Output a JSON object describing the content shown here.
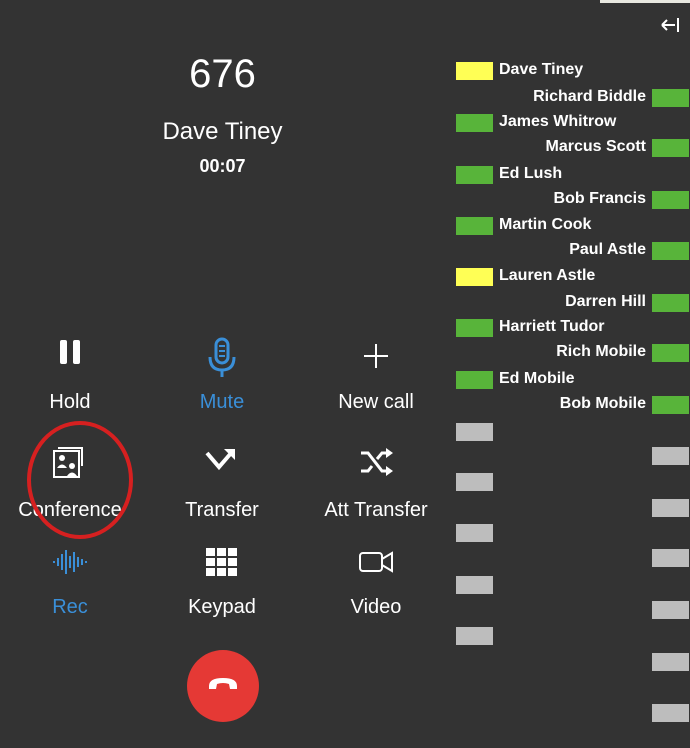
{
  "call": {
    "extension": "676",
    "name": "Dave Tiney",
    "timer": "00:07"
  },
  "controls": {
    "hold": {
      "label": "Hold",
      "icon": "pause-icon"
    },
    "mute": {
      "label": "Mute",
      "icon": "microphone-icon"
    },
    "new_call": {
      "label": "New call",
      "icon": "plus-icon"
    },
    "conference": {
      "label": "Conference",
      "icon": "conference-icon"
    },
    "transfer": {
      "label": "Transfer",
      "icon": "transfer-icon"
    },
    "att_transfer": {
      "label": "Att Transfer",
      "icon": "shuffle-icon"
    },
    "rec": {
      "label": "Rec",
      "icon": "waveform-icon"
    },
    "keypad": {
      "label": "Keypad",
      "icon": "keypad-icon"
    },
    "video": {
      "label": "Video",
      "icon": "video-camera-icon"
    },
    "hangup": {
      "icon": "phone-hangup-icon"
    }
  },
  "colors": {
    "background": "#333333",
    "accent_blue": "#3a8fd8",
    "hangup_red": "#e53935",
    "lamp_green": "#58b43a",
    "lamp_yellow": "#ffff55",
    "lamp_empty": "#bdbdbd",
    "highlight_ring": "#d62020"
  },
  "blf": {
    "contacts": [
      {
        "name": "Dave Tiney",
        "status": "yellow"
      },
      {
        "name": "Richard Biddle",
        "status": "green"
      },
      {
        "name": "James Whitrow",
        "status": "green"
      },
      {
        "name": "Marcus Scott",
        "status": "green"
      },
      {
        "name": "Ed Lush",
        "status": "green"
      },
      {
        "name": "Bob Francis",
        "status": "green"
      },
      {
        "name": "Martin Cook",
        "status": "green"
      },
      {
        "name": "Paul Astle",
        "status": "green"
      },
      {
        "name": "Lauren Astle",
        "status": "yellow"
      },
      {
        "name": "Darren Hill",
        "status": "green"
      },
      {
        "name": "Harriett Tudor",
        "status": "green"
      },
      {
        "name": "Rich Mobile",
        "status": "green"
      },
      {
        "name": "Ed Mobile",
        "status": "green"
      },
      {
        "name": "Bob Mobile",
        "status": "green"
      }
    ],
    "empty_slots": 11
  }
}
